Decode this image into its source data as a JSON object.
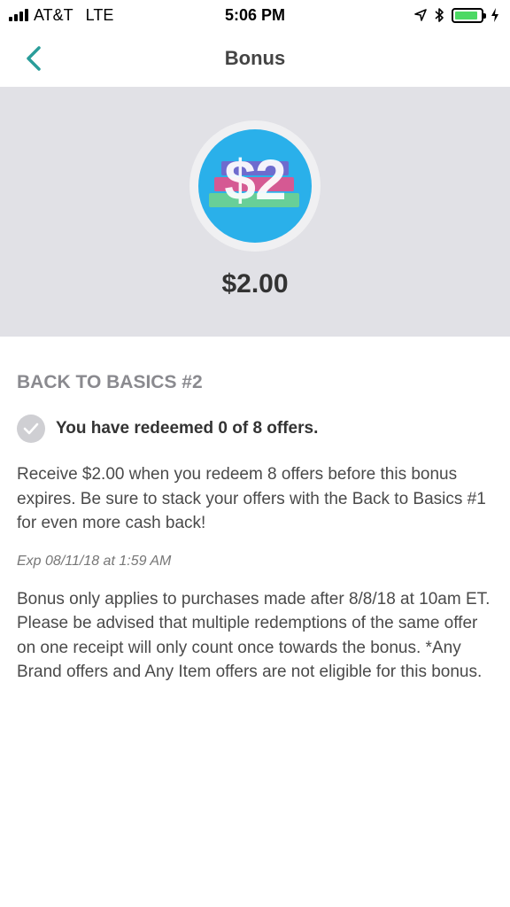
{
  "status_bar": {
    "carrier": "AT&T",
    "network": "LTE",
    "time": "5:06 PM",
    "battery_level": 0.9,
    "battery_color": "#4cd964",
    "icons": [
      "signal-icon",
      "location-icon",
      "bluetooth-icon",
      "battery-icon",
      "charging-icon"
    ]
  },
  "nav": {
    "title": "Bonus",
    "back_icon": "chevron-left-icon",
    "accent_color": "#2a9d9a"
  },
  "hero": {
    "badge_label": "$2",
    "amount": "$2.00",
    "background_color": "#e1e1e6",
    "badge_color": "#2ab0ea"
  },
  "details": {
    "bonus_name": "BACK TO BASICS #2",
    "redeem_status": "You have redeemed 0 of 8 offers.",
    "description": "Receive $2.00 when you redeem 8 offers before this bonus expires. Be sure to stack your offers with the Back to Basics #1 for even more cash back!",
    "expiry": "Exp 08/11/18 at 1:59 AM",
    "fine_print": "Bonus only applies to purchases made after 8/8/18 at 10am ET. Please be advised that multiple redemptions of the same offer on one receipt will only count once towards the bonus. *Any Brand offers and Any Item offers are not eligible for this bonus."
  }
}
